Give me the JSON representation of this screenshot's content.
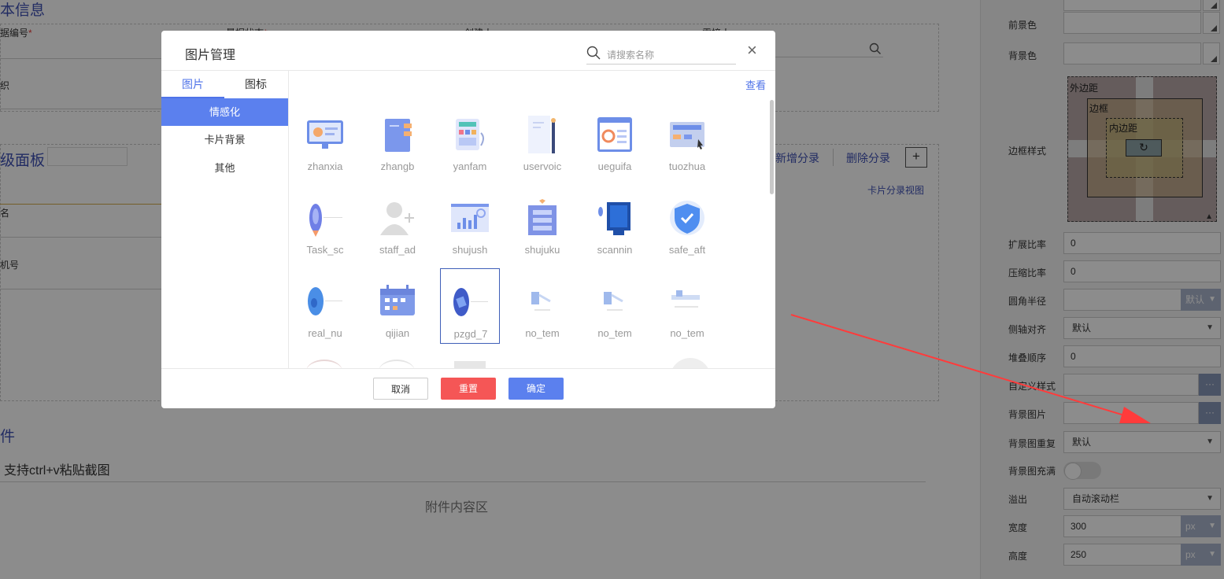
{
  "background": {
    "section_basic": "本信息",
    "fields": {
      "doc_no": "据编号",
      "form_status": "量据状态",
      "creator": "创建人",
      "receiver": "需接人",
      "org": "织",
      "name": "名",
      "phone": "机号"
    },
    "required_mark": "*",
    "section_panel": "级面板",
    "add_section": "新增分录",
    "delete_section": "删除分录",
    "plus": "+",
    "card_view": "卡片分录视图",
    "section_attach": "件",
    "attach_hint": "支持ctrl+v粘贴截图",
    "attach_area": "附件内容区"
  },
  "properties": {
    "foreground_color": "前景色",
    "background_color": "背景色",
    "border_style": "边框样式",
    "box_model": {
      "margin": "外边距",
      "border": "边框",
      "padding": "内边距",
      "content_icon": "refresh-icon"
    },
    "flex_grow": {
      "label": "扩展比率",
      "value": "0"
    },
    "flex_shrink": {
      "label": "压缩比率",
      "value": "0"
    },
    "border_radius": {
      "label": "圆角半径",
      "value": "",
      "unit": "默认"
    },
    "align_self": {
      "label": "侧轴对齐",
      "value": "默认"
    },
    "z_index": {
      "label": "堆叠顺序",
      "value": "0"
    },
    "custom_style": {
      "label": "自定义样式",
      "value": "",
      "button": "···"
    },
    "bg_image": {
      "label": "背景图片",
      "value": "",
      "button": "···"
    },
    "bg_repeat": {
      "label": "背景图重复",
      "value": "默认"
    },
    "bg_fill": {
      "label": "背景图充满",
      "value": false
    },
    "overflow": {
      "label": "溢出",
      "value": "自动滚动栏"
    },
    "width": {
      "label": "宽度",
      "value": "300",
      "unit": "px"
    },
    "height": {
      "label": "高度",
      "value": "250",
      "unit": "px"
    }
  },
  "modal": {
    "title": "图片管理",
    "search_placeholder": "请搜索名称",
    "close": "×",
    "tabs": [
      "图片",
      "图标"
    ],
    "active_tab": "图片",
    "categories": [
      "情感化",
      "卡片背景",
      "其他"
    ],
    "active_category": "情感化",
    "view_link": "查看",
    "images": [
      {
        "name": "zhanxia",
        "icon": "presentation-screen-icon"
      },
      {
        "name": "zhangb",
        "icon": "notebook-icon"
      },
      {
        "name": "yanfam",
        "icon": "research-device-icon"
      },
      {
        "name": "uservoic",
        "icon": "user-voice-icon"
      },
      {
        "name": "ueguifa",
        "icon": "ui-guide-icon"
      },
      {
        "name": "tuozhua",
        "icon": "drag-card-icon"
      },
      {
        "name": "Task_sc",
        "icon": "rocket-icon"
      },
      {
        "name": "staff_ad",
        "icon": "add-staff-icon"
      },
      {
        "name": "shujush",
        "icon": "data-chart-icon"
      },
      {
        "name": "shujuku",
        "icon": "database-icon"
      },
      {
        "name": "scannin",
        "icon": "scanning-icon"
      },
      {
        "name": "safe_aft",
        "icon": "shield-icon"
      },
      {
        "name": "real_nu",
        "icon": "oval-badge-icon"
      },
      {
        "name": "qijian",
        "icon": "calendar-icon"
      },
      {
        "name": "pzgd_7",
        "icon": "oval-card-icon"
      },
      {
        "name": "no_tem",
        "icon": "no-template-icon"
      },
      {
        "name": "no_tem",
        "icon": "no-template-icon"
      },
      {
        "name": "no_tem",
        "icon": "no-template-icon"
      }
    ],
    "selected_image": "pzgd_7",
    "buttons": {
      "cancel": "取消",
      "reset": "重置",
      "ok": "确定"
    }
  },
  "colors": {
    "accent": "#5b80ee",
    "danger": "#f55656",
    "arrow": "#ff3b3b",
    "overlay": "#000000"
  }
}
